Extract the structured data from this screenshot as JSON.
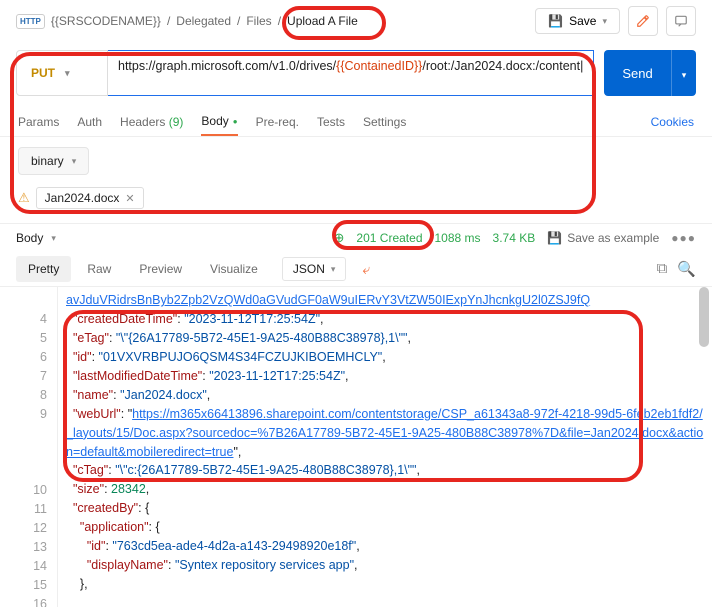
{
  "breadcrumbs": {
    "http_badge": "HTTP",
    "items": [
      "{{SRSCODENAME}}",
      "Delegated",
      "Files"
    ],
    "active": "Upload A File"
  },
  "top": {
    "save": "Save",
    "save_icon": "💾"
  },
  "request": {
    "method": "PUT",
    "url_prefix": "https://graph.microsoft.com/v1.0/drives/",
    "url_var": "{{ContainedID}}",
    "url_suffix": "/root:/Jan2024.docx:/content",
    "send": "Send",
    "tabs": {
      "params": "Params",
      "auth": "Auth",
      "headers_label": "Headers",
      "headers_count": "(9)",
      "body": "Body",
      "prereq": "Pre-req.",
      "tests": "Tests",
      "settings": "Settings",
      "cookies": "Cookies"
    },
    "body_type": "binary",
    "file_name": "Jan2024.docx"
  },
  "response": {
    "label": "Body",
    "status_code": "201",
    "status_text": "Created",
    "time": "1088 ms",
    "size": "3.74 KB",
    "save_example": "Save as example",
    "views": {
      "pretty": "Pretty",
      "raw": "Raw",
      "preview": "Preview",
      "visualize": "Visualize",
      "format": "JSON"
    }
  },
  "json_lines": [
    {
      "n": "",
      "indent": 1,
      "type": "truncated_link",
      "text": "avJduVRidrsBnByb2Zpb2VzQWd0aGVudGF0aW9uIERvY3VtZW50IExpYnJhcnkgU2l0ZSJ9fQ"
    },
    {
      "n": "4",
      "indent": 1,
      "key": "createdDateTime",
      "val_str": "2023-11-12T17:25:54Z"
    },
    {
      "n": "5",
      "indent": 1,
      "key": "eTag",
      "val_str": "\\\"{26A17789-5B72-45E1-9A25-480B88C38978},1\\\""
    },
    {
      "n": "6",
      "indent": 1,
      "key": "id",
      "val_str": "01VXVRBPUJO6QSM4S34FCZUJKIBOEMHCLY"
    },
    {
      "n": "7",
      "indent": 1,
      "key": "lastModifiedDateTime",
      "val_str": "2023-11-12T17:25:54Z"
    },
    {
      "n": "8",
      "indent": 1,
      "key": "name",
      "val_str": "Jan2024.docx"
    },
    {
      "n": "9",
      "indent": 1,
      "key": "webUrl",
      "val_link": "https://m365x66413896.sharepoint.com/contentstorage/CSP_a61343a8-972f-4218-99d5-6feb2eb1fdf2/_layouts/15/Doc.aspx?sourcedoc=%7B26A17789-5B72-45E1-9A25-480B88C38978%7D&file=Jan2024.docx&action=default&mobileredirect=true"
    },
    {
      "n": "10",
      "indent": 1,
      "type": "obscured",
      "key": "cTag",
      "val_str": "\\\"c:{26A17789-5B72-45E1-9A25-480B88C38978},1\\\""
    },
    {
      "n": "11",
      "indent": 1,
      "key": "size",
      "val_num": "28342"
    },
    {
      "n": "12",
      "indent": 1,
      "key": "createdBy",
      "open_obj": true
    },
    {
      "n": "13",
      "indent": 2,
      "key": "application",
      "open_obj": true
    },
    {
      "n": "14",
      "indent": 3,
      "key": "id",
      "val_str": "763cd5ea-ade4-4d2a-a143-29498920e18f"
    },
    {
      "n": "15",
      "indent": 3,
      "key": "displayName",
      "val_str": "Syntex repository services app"
    },
    {
      "n": "16",
      "indent": 2,
      "close_obj": true,
      "trailing_comma": true
    }
  ]
}
